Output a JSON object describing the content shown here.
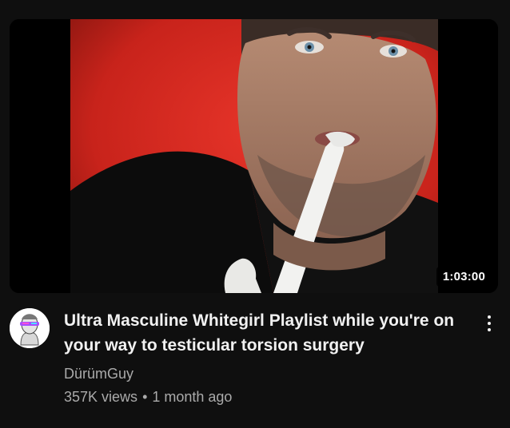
{
  "video": {
    "title": "Ultra Masculine Whitegirl Playlist while you're on your way to testicular torsion surgery",
    "duration": "1:03:00",
    "channel": "DürümGuy",
    "views": "357K views",
    "separator": "•",
    "age": "1 month ago"
  },
  "icons": {
    "more": "vertical-ellipsis-icon",
    "avatar": "channel-avatar"
  },
  "colors": {
    "background": "#0f0f0f",
    "title": "#f1f1f1",
    "secondary_text": "#aaaaaa",
    "thumbnail_backdrop": "#d42a1e"
  }
}
